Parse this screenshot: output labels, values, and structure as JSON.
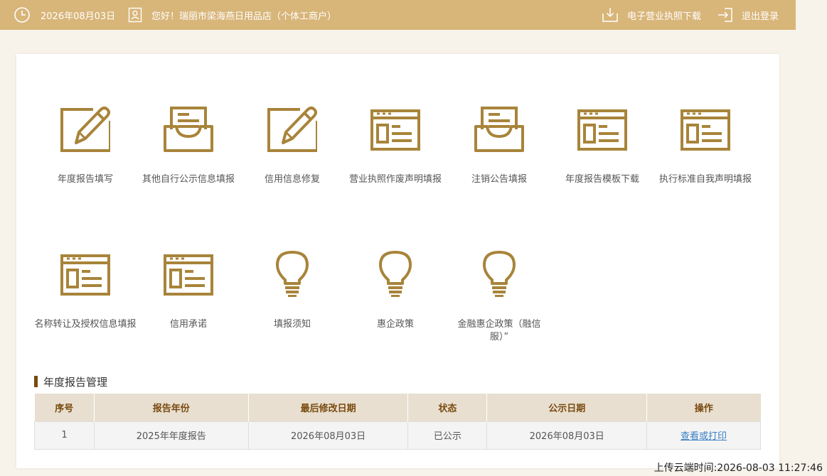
{
  "topbar": {
    "date": "2026年08月03日",
    "greeting": "您好！瑞丽市梁海燕日用品店（个体工商户）",
    "download_label": "电子营业执照下载",
    "logout_label": "退出登录",
    "bg_color": "#d8b579"
  },
  "tiles": [
    {
      "label": "年度报告填写",
      "icon": "edit-pencil-icon"
    },
    {
      "label": "其他自行公示信息填报",
      "icon": "inbox-tray-icon"
    },
    {
      "label": "信用信息修复",
      "icon": "edit-pencil-icon"
    },
    {
      "label": "营业执照作废声明填报",
      "icon": "web-form-icon"
    },
    {
      "label": "注销公告填报",
      "icon": "inbox-tray-icon"
    },
    {
      "label": "年度报告模板下载",
      "icon": "web-form-icon"
    },
    {
      "label": "执行标准自我声明填报",
      "icon": "web-form-icon"
    },
    {
      "label": "名称转让及授权信息填报",
      "icon": "web-form-icon"
    },
    {
      "label": "信用承诺",
      "icon": "web-form-icon"
    },
    {
      "label": "填报须知",
      "icon": "lightbulb-icon"
    },
    {
      "label": "惠企政策",
      "icon": "lightbulb-icon"
    },
    {
      "label": "金融惠企政策（融信服）”",
      "icon": "lightbulb-icon"
    }
  ],
  "icon_color": "#a8843a",
  "section": {
    "title": "年度报告管理"
  },
  "table": {
    "headers": [
      "序号",
      "报告年份",
      "最后修改日期",
      "状态",
      "公示日期",
      "操作"
    ],
    "rows": [
      {
        "index": "1",
        "year": "2025年年度报告",
        "modified": "2026年08月03日",
        "status": "已公示",
        "published": "2026年08月03日",
        "action": "查看或打印"
      }
    ]
  },
  "footer": {
    "upload_time": "上传云端时间:2026-08-03 11:27:46"
  }
}
